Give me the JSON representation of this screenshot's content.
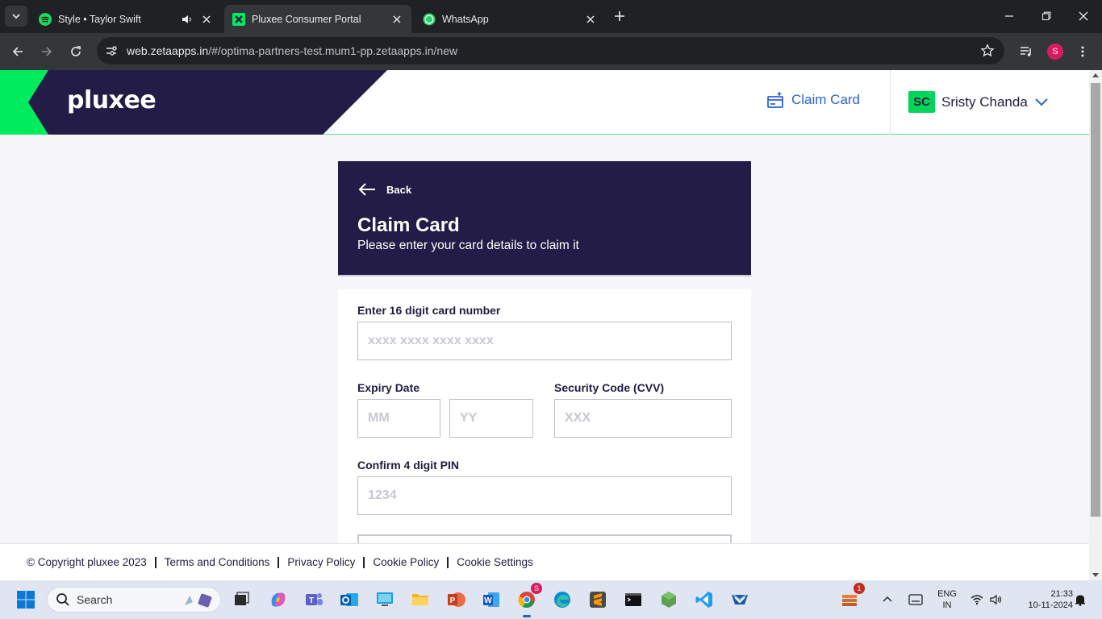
{
  "browser": {
    "tabs": [
      {
        "title": "Style • Taylor Swift",
        "icon": "spotify-icon",
        "audio": true
      },
      {
        "title": "Pluxee Consumer Portal",
        "icon": "pluxee-icon",
        "active": true
      },
      {
        "title": "WhatsApp",
        "icon": "whatsapp-icon"
      }
    ],
    "url_host": "web.zetaapps.in",
    "url_path": "/#/optima-partners-test.mum1-pp.zetaapps.in/new",
    "profile_initial": "S"
  },
  "header": {
    "brand": "pluxee",
    "claim_card_label": "Claim Card",
    "user_initials": "SC",
    "user_name": "Sristy Chanda"
  },
  "card": {
    "back_label": "Back",
    "title": "Claim Card",
    "subtitle": "Please enter your card details to claim it"
  },
  "form": {
    "card_number_label": "Enter 16 digit card number",
    "card_number_placeholder": "xxxx xxxx xxxx xxxx",
    "expiry_label": "Expiry Date",
    "month_placeholder": "MM",
    "year_placeholder": "YY",
    "cvv_label": "Security Code (CVV)",
    "cvv_placeholder": "XXX",
    "pin_label": "Confirm 4 digit PIN",
    "pin_placeholder": "1234"
  },
  "footer": {
    "copyright": "© Copyright pluxee 2023",
    "links": [
      "Terms and Conditions",
      "Privacy Policy",
      "Cookie Policy",
      "Cookie Settings"
    ]
  },
  "taskbar": {
    "search_label": "Search",
    "chrome_badge": "S",
    "notification_count": "1",
    "lang_line1": "ENG",
    "lang_line2": "IN",
    "time": "21:33",
    "date": "10-11-2024"
  },
  "colors": {
    "brand_navy": "#221c46",
    "brand_green": "#00eb5e",
    "link_blue": "#2a63d4"
  }
}
